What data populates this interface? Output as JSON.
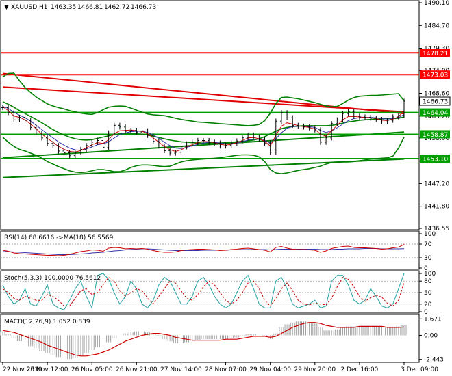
{
  "chart_data": {
    "type": "line",
    "symbol_header": "XAUUSD,H1",
    "ohlc": {
      "open": "1463.35",
      "high": "1466.81",
      "low": "1462.72",
      "close": "1466.73"
    },
    "price_panel": {
      "ylim": [
        1436.55,
        1490.1
      ],
      "y_ticks": [
        "1490.10",
        "1484.70",
        "1479.30",
        "1474.00",
        "1468.60",
        "1463.20",
        "1458.00",
        "1452.50",
        "1447.20",
        "1441.80",
        "1436.55"
      ],
      "current_price": "1466.73",
      "price_labels": [
        {
          "value": "1478.21",
          "color": "#ff0000"
        },
        {
          "value": "1473.03",
          "color": "#ff0000"
        },
        {
          "value": "1464.04",
          "color": "#00a000"
        },
        {
          "value": "1458.87",
          "color": "#00a000"
        },
        {
          "value": "1453.10",
          "color": "#00a000"
        }
      ],
      "close": [
        1465.2,
        1464.0,
        1462.3,
        1462.9,
        1462.2,
        1460.5,
        1459.2,
        1458.0,
        1456.7,
        1456.2,
        1454.9,
        1454.5,
        1453.8,
        1454.6,
        1455.3,
        1456.2,
        1457.0,
        1457.4,
        1455.8,
        1459.2,
        1461.0,
        1460.6,
        1459.6,
        1459.8,
        1459.4,
        1459.7,
        1458.6,
        1457.2,
        1456.1,
        1455.0,
        1454.4,
        1454.6,
        1455.9,
        1456.6,
        1457.0,
        1457.4,
        1457.4,
        1457.0,
        1456.8,
        1456.1,
        1456.3,
        1456.8,
        1457.3,
        1458.0,
        1458.7,
        1458.2,
        1457.6,
        1456.8,
        1454.6,
        1462.0,
        1464.0,
        1462.8,
        1461.0,
        1460.8,
        1460.6,
        1460.4,
        1459.9,
        1457.0,
        1458.0,
        1461.4,
        1462.3,
        1463.8,
        1464.2,
        1463.2,
        1463.0,
        1462.9,
        1462.7,
        1462.4,
        1461.8,
        1462.2,
        1463.0,
        1463.35,
        1466.73
      ],
      "ma_fast": [
        1465.4,
        1464.5,
        1463.2,
        1462.9,
        1462.3,
        1461.3,
        1460.2,
        1458.9,
        1457.9,
        1457.0,
        1456.0,
        1455.3,
        1454.8,
        1454.7,
        1455.0,
        1455.7,
        1456.4,
        1456.9,
        1456.7,
        1457.6,
        1459.0,
        1459.7,
        1459.8,
        1459.9,
        1459.7,
        1459.6,
        1459.0,
        1458.0,
        1457.0,
        1456.0,
        1455.2,
        1454.8,
        1455.2,
        1455.9,
        1456.4,
        1456.9,
        1457.2,
        1457.1,
        1456.9,
        1456.5,
        1456.3,
        1456.5,
        1456.9,
        1457.4,
        1458.0,
        1458.1,
        1457.8,
        1457.2,
        1456.1,
        1458.6,
        1460.8,
        1461.6,
        1461.3,
        1460.9,
        1460.7,
        1460.5,
        1460.1,
        1458.9,
        1458.4,
        1459.7,
        1461.0,
        1462.3,
        1463.1,
        1463.1,
        1463.0,
        1462.9,
        1462.8,
        1462.6,
        1462.2,
        1462.1,
        1462.5,
        1463.0,
        1464.5
      ],
      "ma_slow": [
        1465.5,
        1465.0,
        1464.1,
        1463.4,
        1462.8,
        1462.0,
        1461.0,
        1460.0,
        1459.0,
        1458.0,
        1457.1,
        1456.3,
        1455.6,
        1455.2,
        1455.1,
        1455.4,
        1455.9,
        1456.4,
        1456.6,
        1457.1,
        1458.0,
        1458.8,
        1459.2,
        1459.5,
        1459.6,
        1459.6,
        1459.3,
        1458.7,
        1457.9,
        1457.0,
        1456.2,
        1455.6,
        1455.5,
        1455.8,
        1456.1,
        1456.5,
        1456.8,
        1457.0,
        1457.0,
        1456.8,
        1456.6,
        1456.6,
        1456.8,
        1457.1,
        1457.5,
        1457.7,
        1457.7,
        1457.4,
        1456.8,
        1457.8,
        1459.2,
        1460.3,
        1460.7,
        1460.8,
        1460.8,
        1460.7,
        1460.5,
        1459.8,
        1459.3,
        1459.7,
        1460.4,
        1461.3,
        1462.1,
        1462.6,
        1462.8,
        1462.9,
        1462.9,
        1462.8,
        1462.6,
        1462.5,
        1462.6,
        1462.8,
        1463.6
      ],
      "bollinger_upper": [
        1472.5,
        1473.3,
        1473.4,
        1471.6,
        1470.0,
        1468.8,
        1467.7,
        1466.9,
        1466.1,
        1465.6,
        1465.2,
        1464.9,
        1464.5,
        1464.2,
        1463.9,
        1463.7,
        1463.6,
        1464.0,
        1464.7,
        1465.3,
        1465.5,
        1465.6,
        1465.5,
        1465.1,
        1464.6,
        1464.1,
        1463.7,
        1463.5,
        1463.4,
        1463.3,
        1463.0,
        1462.7,
        1462.4,
        1462.2,
        1462.0,
        1461.8,
        1461.7,
        1461.6,
        1461.5,
        1461.4,
        1461.3,
        1461.2,
        1461.1,
        1461.0,
        1460.9,
        1461.0,
        1461.2,
        1462.1,
        1463.9,
        1466.2,
        1467.6,
        1467.7,
        1467.5,
        1467.3,
        1467.0,
        1466.7,
        1466.4,
        1466.0,
        1465.6,
        1465.4,
        1465.5,
        1466.2,
        1467.0,
        1467.6,
        1467.9,
        1468.0,
        1468.1,
        1468.1,
        1468.2,
        1468.3,
        1468.4,
        1468.5,
        1466.8
      ],
      "bollinger_lower": [
        1458.2,
        1457.0,
        1456.0,
        1455.3,
        1454.9,
        1454.4,
        1453.9,
        1453.2,
        1452.4,
        1451.8,
        1451.2,
        1450.7,
        1450.2,
        1449.9,
        1449.8,
        1449.9,
        1450.2,
        1450.5,
        1450.5,
        1450.3,
        1450.0,
        1450.0,
        1450.4,
        1451.0,
        1451.4,
        1451.6,
        1451.6,
        1451.5,
        1451.3,
        1451.2,
        1451.3,
        1451.8,
        1452.3,
        1452.6,
        1452.8,
        1452.9,
        1453.0,
        1453.1,
        1453.2,
        1453.3,
        1453.5,
        1453.7,
        1453.9,
        1454.0,
        1454.0,
        1453.9,
        1453.5,
        1452.4,
        1450.5,
        1449.7,
        1449.5,
        1449.7,
        1450.0,
        1450.3,
        1450.5,
        1450.7,
        1451.0,
        1451.3,
        1451.8,
        1452.2,
        1452.3,
        1452.3,
        1452.3,
        1452.4,
        1452.6,
        1452.8,
        1453.0,
        1453.1,
        1453.2,
        1453.3,
        1453.7,
        1455.6,
        1458.2
      ],
      "bollinger_mid": [
        1466.6,
        1466.0,
        1465.3,
        1464.5,
        1463.8,
        1463.1,
        1462.4,
        1461.6,
        1460.8,
        1460.0,
        1459.3,
        1458.7,
        1458.2,
        1457.8,
        1457.6,
        1457.5,
        1457.6,
        1457.9,
        1458.2,
        1458.5,
        1458.8,
        1459.0,
        1459.1,
        1459.1,
        1459.0,
        1458.9,
        1458.7,
        1458.4,
        1458.1,
        1457.8,
        1457.5,
        1457.3,
        1457.1,
        1457.0,
        1456.9,
        1456.8,
        1456.8,
        1456.8,
        1456.8,
        1456.8,
        1456.9,
        1457.0,
        1457.1,
        1457.2,
        1457.3,
        1457.5,
        1457.8,
        1458.3,
        1459.0,
        1459.6,
        1460.2,
        1460.5,
        1460.7,
        1460.8,
        1460.9,
        1460.9,
        1460.9,
        1460.9,
        1460.9,
        1461.0,
        1461.2,
        1461.5,
        1461.8,
        1462.0,
        1462.2,
        1462.3,
        1462.4,
        1462.5,
        1462.5,
        1462.6,
        1462.6,
        1462.7,
        1463.0
      ],
      "trendlines": [
        {
          "color": "#e00000",
          "points": [
            [
              0,
              1473.3
            ],
            [
              72,
              1463.8
            ]
          ]
        },
        {
          "color": "#e00000",
          "points": [
            [
              0,
              1470.1
            ],
            [
              72,
              1464.2
            ]
          ]
        },
        {
          "color": "#008000",
          "points": [
            [
              0,
              1448.6
            ],
            [
              72,
              1453.0
            ]
          ]
        },
        {
          "color": "#008000",
          "points": [
            [
              0,
              1453.3
            ],
            [
              72,
              1459.4
            ]
          ]
        }
      ]
    },
    "rsi_panel": {
      "label": "RSI(14) 68.6616 ->MA(18) 56.5569",
      "ylim": [
        0,
        100
      ],
      "y_ticks": [
        "100",
        "70",
        "30",
        "0"
      ],
      "rsi": [
        52,
        49,
        44,
        42,
        41,
        40,
        39,
        38,
        37,
        37,
        36,
        37,
        40,
        44,
        48,
        50,
        53,
        52,
        49,
        58,
        60,
        59,
        56,
        57,
        56,
        57,
        55,
        51,
        48,
        46,
        46,
        47,
        51,
        53,
        54,
        55,
        55,
        54,
        53,
        51,
        52,
        54,
        55,
        57,
        58,
        56,
        54,
        52,
        47,
        60,
        63,
        58,
        55,
        54,
        54,
        53,
        52,
        46,
        50,
        57,
        60,
        63,
        64,
        60,
        59,
        59,
        58,
        57,
        55,
        56,
        59,
        61,
        68.7
      ],
      "ma": [
        48,
        48,
        47,
        46,
        45,
        44,
        43,
        42,
        41,
        40,
        39,
        39,
        39,
        40,
        41,
        42,
        44,
        45,
        46,
        48,
        50,
        51,
        53,
        54,
        55,
        56,
        56,
        55,
        54,
        53,
        52,
        51,
        51,
        51,
        51,
        51,
        52,
        52,
        52,
        52,
        52,
        53,
        53,
        54,
        54,
        54,
        54,
        54,
        53,
        54,
        55,
        55,
        55,
        55,
        55,
        55,
        55,
        54,
        54,
        54,
        55,
        55,
        56,
        56,
        56,
        57,
        57,
        57,
        56,
        56,
        56,
        56,
        56.6
      ]
    },
    "stoch_panel": {
      "label": "Stoch(5,3,3) 100.0000 76.5612",
      "ylim": [
        0,
        100
      ],
      "y_ticks": [
        "100",
        "80",
        "50",
        "20",
        "0"
      ],
      "k": [
        70,
        40,
        20,
        30,
        60,
        20,
        15,
        40,
        70,
        20,
        10,
        5,
        30,
        60,
        80,
        40,
        10,
        95,
        100,
        85,
        50,
        20,
        40,
        80,
        60,
        20,
        10,
        30,
        70,
        90,
        80,
        50,
        20,
        20,
        40,
        80,
        90,
        70,
        40,
        20,
        10,
        20,
        50,
        80,
        95,
        60,
        20,
        10,
        10,
        80,
        90,
        60,
        20,
        10,
        15,
        20,
        30,
        10,
        15,
        80,
        95,
        95,
        70,
        30,
        20,
        30,
        60,
        40,
        15,
        10,
        20,
        60,
        100
      ],
      "d": [
        60,
        50,
        35,
        30,
        40,
        35,
        30,
        30,
        45,
        40,
        30,
        15,
        15,
        35,
        55,
        60,
        45,
        50,
        70,
        90,
        80,
        55,
        40,
        50,
        60,
        55,
        35,
        20,
        40,
        60,
        80,
        75,
        55,
        35,
        30,
        45,
        65,
        80,
        70,
        50,
        30,
        20,
        30,
        50,
        75,
        80,
        60,
        30,
        15,
        35,
        60,
        75,
        55,
        30,
        20,
        18,
        22,
        20,
        18,
        35,
        65,
        90,
        85,
        65,
        40,
        27,
        37,
        43,
        38,
        22,
        15,
        30,
        76.6
      ]
    },
    "macd_panel": {
      "label": "MACD(12,26,9) 1.052 0.839",
      "y_ticks": [
        "1.671",
        "0.00",
        "-2.443"
      ],
      "ylim": [
        -2.6,
        1.9
      ],
      "histogram": [
        0.4,
        0.1,
        -0.3,
        -0.6,
        -0.8,
        -1.1,
        -1.3,
        -1.6,
        -1.8,
        -2.0,
        -2.2,
        -2.3,
        -2.4,
        -2.3,
        -2.1,
        -1.8,
        -1.5,
        -1.2,
        -1.1,
        -0.7,
        -0.3,
        0.0,
        0.2,
        0.3,
        0.4,
        0.4,
        0.3,
        0.1,
        -0.1,
        -0.4,
        -0.6,
        -0.8,
        -0.8,
        -0.7,
        -0.6,
        -0.5,
        -0.4,
        -0.4,
        -0.4,
        -0.4,
        -0.4,
        -0.3,
        -0.2,
        -0.1,
        0.1,
        0.1,
        0.0,
        -0.1,
        -0.4,
        0.2,
        0.8,
        1.1,
        1.3,
        1.4,
        1.4,
        1.3,
        1.2,
        0.8,
        0.5,
        0.5,
        0.6,
        0.8,
        0.9,
        0.9,
        0.9,
        0.9,
        0.9,
        0.9,
        0.8,
        0.8,
        0.8,
        0.9,
        1.05
      ],
      "signal": [
        0.5,
        0.4,
        0.3,
        0.1,
        -0.1,
        -0.3,
        -0.5,
        -0.7,
        -1.0,
        -1.2,
        -1.4,
        -1.6,
        -1.8,
        -2.0,
        -2.1,
        -2.1,
        -2.0,
        -1.9,
        -1.7,
        -1.5,
        -1.2,
        -0.9,
        -0.6,
        -0.4,
        -0.2,
        0.0,
        0.1,
        0.2,
        0.2,
        0.1,
        0.0,
        -0.2,
        -0.3,
        -0.4,
        -0.5,
        -0.5,
        -0.5,
        -0.5,
        -0.5,
        -0.5,
        -0.4,
        -0.4,
        -0.4,
        -0.3,
        -0.2,
        -0.1,
        -0.1,
        -0.1,
        -0.2,
        -0.1,
        0.2,
        0.5,
        0.8,
        1.0,
        1.2,
        1.3,
        1.3,
        1.2,
        1.0,
        0.9,
        0.8,
        0.8,
        0.8,
        0.8,
        0.9,
        0.9,
        0.9,
        0.9,
        0.9,
        0.8,
        0.8,
        0.8,
        0.84
      ]
    },
    "x_tick_labels": [
      "22 Nov 2019",
      "25 Nov 12:00",
      "26 Nov 05:00",
      "26 Nov 21:00",
      "27 Nov 14:00",
      "28 Nov 07:00",
      "29 Nov 04:00",
      "29 Nov 20:00",
      "2 Dec 16:00",
      "3 Dec 09:00"
    ],
    "grid": true
  },
  "colors": {
    "background": "#ffffff",
    "price_line": "#000000",
    "ma_fast": "#cc0000",
    "ma_slow": "#3333aa",
    "bollinger": "#008000",
    "rsi": "#cc0000",
    "rsi_ma": "#3333aa",
    "stoch_k": "#20a0a0",
    "stoch_d": "#cc0000",
    "macd_hist": "#a0a0a0",
    "macd_signal": "#cc0000",
    "resistance": "#ff0000",
    "support": "#008000",
    "current_price_box": "#ffffff"
  }
}
